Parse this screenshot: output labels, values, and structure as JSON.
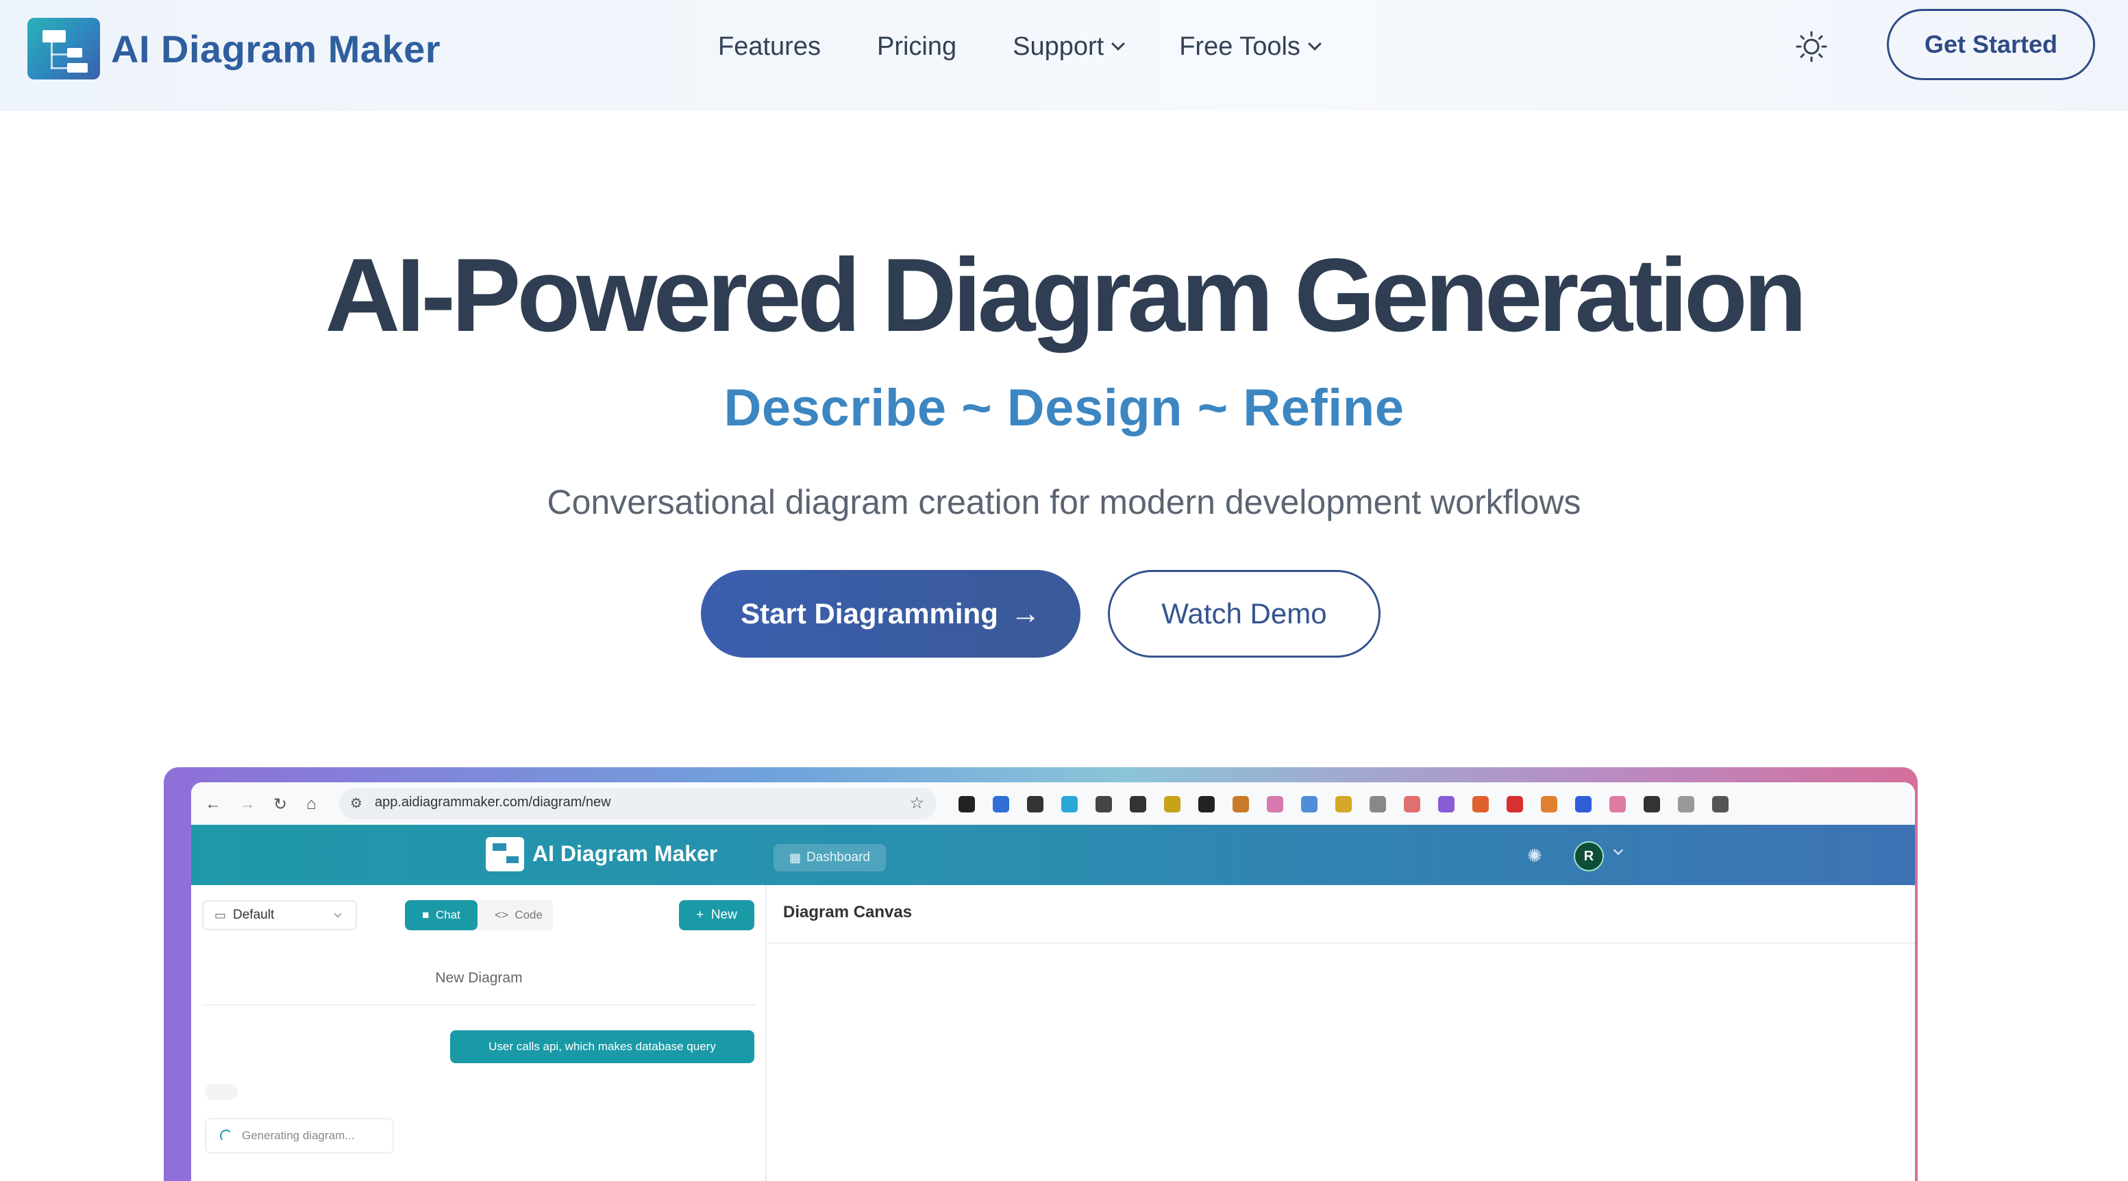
{
  "nav": {
    "brand": "AI Diagram Maker",
    "links": [
      {
        "label": "Features",
        "dropdown": false
      },
      {
        "label": "Pricing",
        "dropdown": false
      },
      {
        "label": "Support",
        "dropdown": true
      },
      {
        "label": "Free Tools",
        "dropdown": true
      }
    ],
    "cta": "Get Started"
  },
  "hero": {
    "title": "AI-Powered Diagram Generation",
    "subtitle": "Describe ~ Design ~ Refine",
    "description": "Conversational diagram creation for modern development workflows",
    "primary_button": "Start Diagramming",
    "primary_arrow": "→",
    "secondary_button": "Watch Demo"
  },
  "preview": {
    "url": "app.aidiagrammaker.com/diagram/new",
    "app_title": "AI Diagram Maker",
    "dashboard_label": "Dashboard",
    "avatar_initial": "R",
    "folder_select": "Default",
    "tab_chat": "Chat",
    "tab_code": "Code",
    "new_button": "New",
    "chat_title": "New Diagram",
    "user_message": "User calls api, which makes database query",
    "status_message": "Generating diagram...",
    "canvas_title": "Diagram Canvas",
    "extension_colors": [
      "#222222",
      "#2f6fd6",
      "#333333",
      "#2aa7d6",
      "#444444",
      "#333333",
      "#c8a218",
      "#222222",
      "#c87a2a",
      "#d67ab0",
      "#4d8fd6",
      "#d6a62a",
      "#888888",
      "#e07070",
      "#8a5cd6",
      "#e06030",
      "#d63030",
      "#e08030",
      "#2f5fd6",
      "#e07aa0",
      "#333333",
      "#999999",
      "#555555"
    ]
  },
  "colors": {
    "brand_blue": "#2f5e9e",
    "accent_blue": "#3c86c2",
    "primary_button": "#3b5fae",
    "teal": "#1a9aa7"
  }
}
